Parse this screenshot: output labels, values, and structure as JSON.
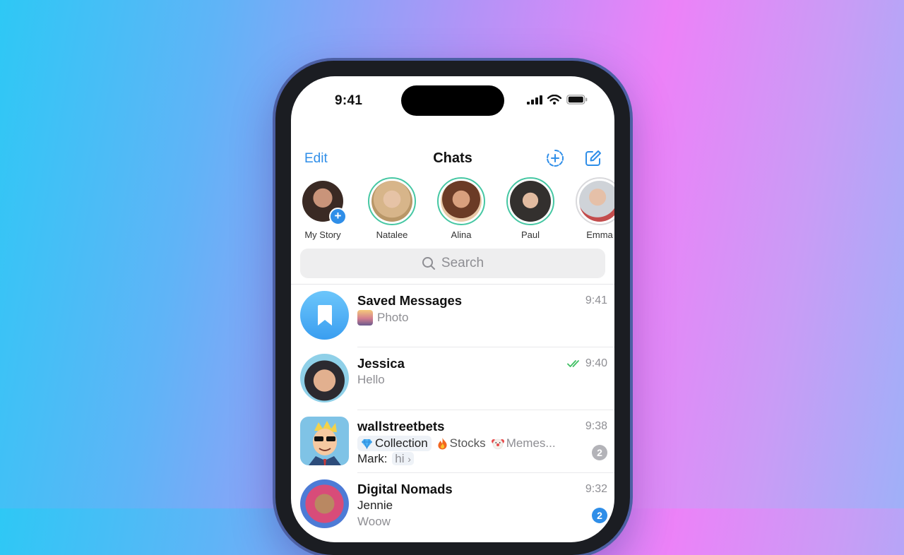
{
  "status": {
    "time": "9:41"
  },
  "nav": {
    "edit": "Edit",
    "title": "Chats"
  },
  "stories": [
    {
      "name": "My Story",
      "ring": false,
      "plus": "+"
    },
    {
      "name": "Natalee",
      "ring": true
    },
    {
      "name": "Alina",
      "ring": true
    },
    {
      "name": "Paul",
      "ring": true
    },
    {
      "name": "Emma",
      "ring": false
    }
  ],
  "search": {
    "placeholder": "Search"
  },
  "chats": [
    {
      "name": "Saved Messages",
      "time": "9:41",
      "preview": "Photo"
    },
    {
      "name": "Jessica",
      "time": "9:40",
      "preview": "Hello",
      "read": true
    },
    {
      "name": "wallstreetbets",
      "time": "9:38",
      "topics": [
        {
          "icon": "gem-icon",
          "label": "Collection"
        },
        {
          "icon": "fire-icon",
          "label": "Stocks"
        },
        {
          "icon": "clown-icon",
          "label": "Memes..."
        }
      ],
      "sender": "Mark:",
      "message": "hi",
      "unread": "2",
      "muted": true
    },
    {
      "name": "Digital Nomads",
      "time": "9:32",
      "sender": "Jennie",
      "message": "Woow",
      "unread": "2",
      "muted": false
    }
  ],
  "colors": {
    "accent": "#2f8ee8",
    "story_ring": "#46c7a3",
    "muted_badge": "#b3b3b8",
    "read_check": "#3fbf62"
  }
}
